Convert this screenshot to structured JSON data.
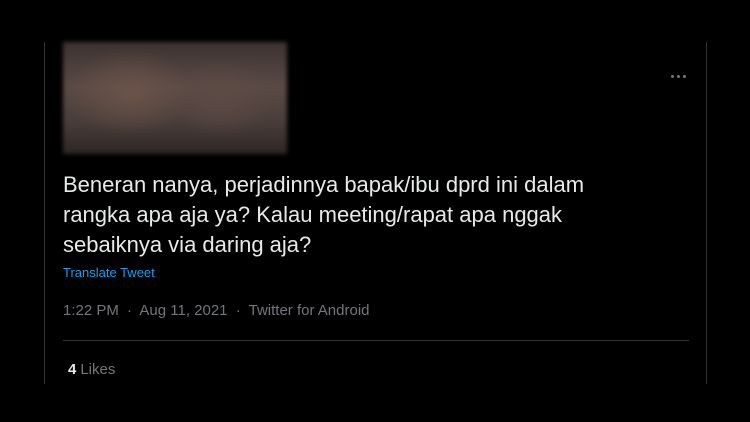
{
  "tweet": {
    "text": "Beneran nanya, perjadinnya bapak/ibu dprd ini dalam\nrangka apa aja ya? Kalau meeting/rapat apa nggak\nsebaiknya via daring aja?",
    "translate_label": "Translate Tweet",
    "time": "1:22 PM",
    "separator": "·",
    "date": "Aug 11, 2021",
    "source": "Twitter for Android",
    "likes_count": "4",
    "likes_label": "Likes"
  },
  "icons": {
    "more": "more-horizontal-icon"
  },
  "colors": {
    "background": "#000000",
    "text_primary": "#e7e9ea",
    "text_secondary": "#71767b",
    "link": "#1d9bf0",
    "border": "#2f3336"
  }
}
